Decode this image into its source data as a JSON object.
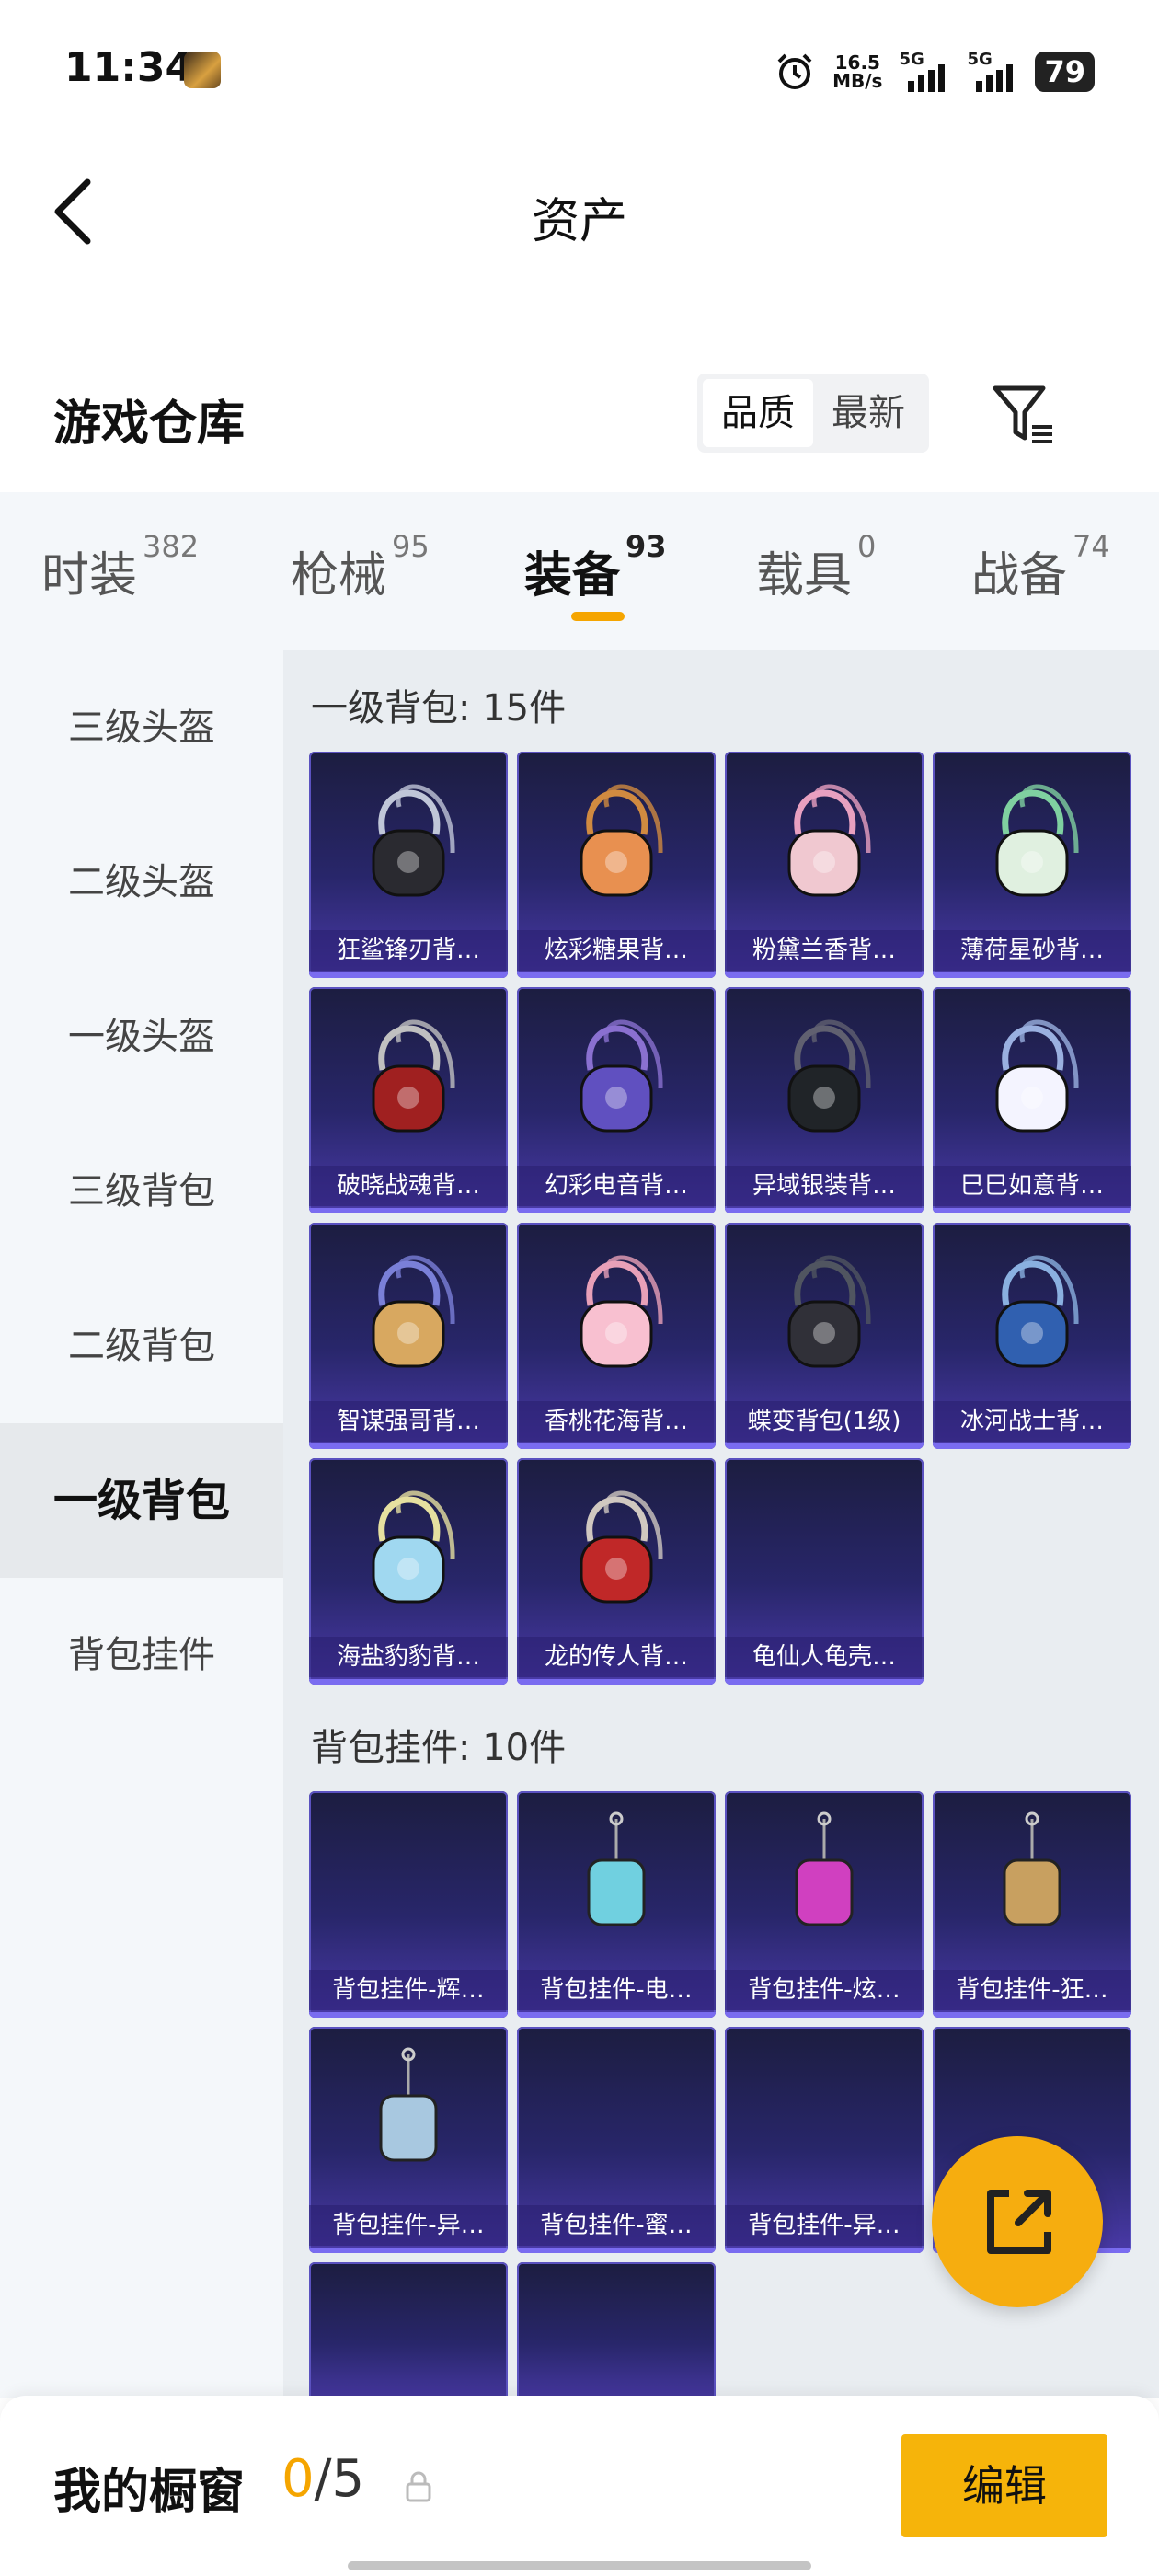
{
  "status_bar": {
    "time": "11:34",
    "net_speed_value": "16.5",
    "net_speed_unit": "MB/s",
    "sim1": "5G",
    "sim2": "5G",
    "battery": "79"
  },
  "header": {
    "title": "资产"
  },
  "section": {
    "title": "游戏仓库",
    "sort_options": [
      "品质",
      "最新"
    ],
    "sort_selected": "品质"
  },
  "tabs": [
    {
      "label": "时装",
      "count": "382"
    },
    {
      "label": "枪械",
      "count": "95"
    },
    {
      "label": "装备",
      "count": "93",
      "active": true
    },
    {
      "label": "载具",
      "count": "0"
    },
    {
      "label": "战备",
      "count": "74"
    }
  ],
  "sidebar": {
    "items": [
      "三级头盔",
      "二级头盔",
      "一级头盔",
      "三级背包",
      "二级背包",
      "一级背包",
      "背包挂件"
    ],
    "selected": "一级背包"
  },
  "groups": [
    {
      "title": "一级背包: 15件",
      "items": [
        "狂鲨锋刃背…",
        "炫彩糖果背…",
        "粉黛兰香背…",
        "薄荷星砂背…",
        "破晓战魂背…",
        "幻彩电音背…",
        "异域银装背…",
        "巳巳如意背…",
        "智谋强哥背…",
        "香桃花海背…",
        "蝶变背包(1级)",
        "冰河战士背…",
        "海盐豹豹背…",
        "龙的传人背…",
        "龟仙人龟壳…"
      ]
    },
    {
      "title": "背包挂件: 10件",
      "items": [
        "背包挂件-辉…",
        "背包挂件-电…",
        "背包挂件-炫…",
        "背包挂件-狂…",
        "背包挂件-异…",
        "背包挂件-蜜…",
        "背包挂件-异…",
        "",
        "",
        ""
      ]
    }
  ],
  "bottom_bar": {
    "showcase_label": "我的橱窗",
    "showcase_current": "0",
    "showcase_total": "/5",
    "edit_label": "编辑"
  },
  "colors": {
    "accent": "#f5a500",
    "card_bg": "#28266a",
    "card_border": "#5b52c0"
  },
  "icons": [
    "back-icon",
    "filter-icon",
    "share-icon",
    "lock-icon"
  ]
}
